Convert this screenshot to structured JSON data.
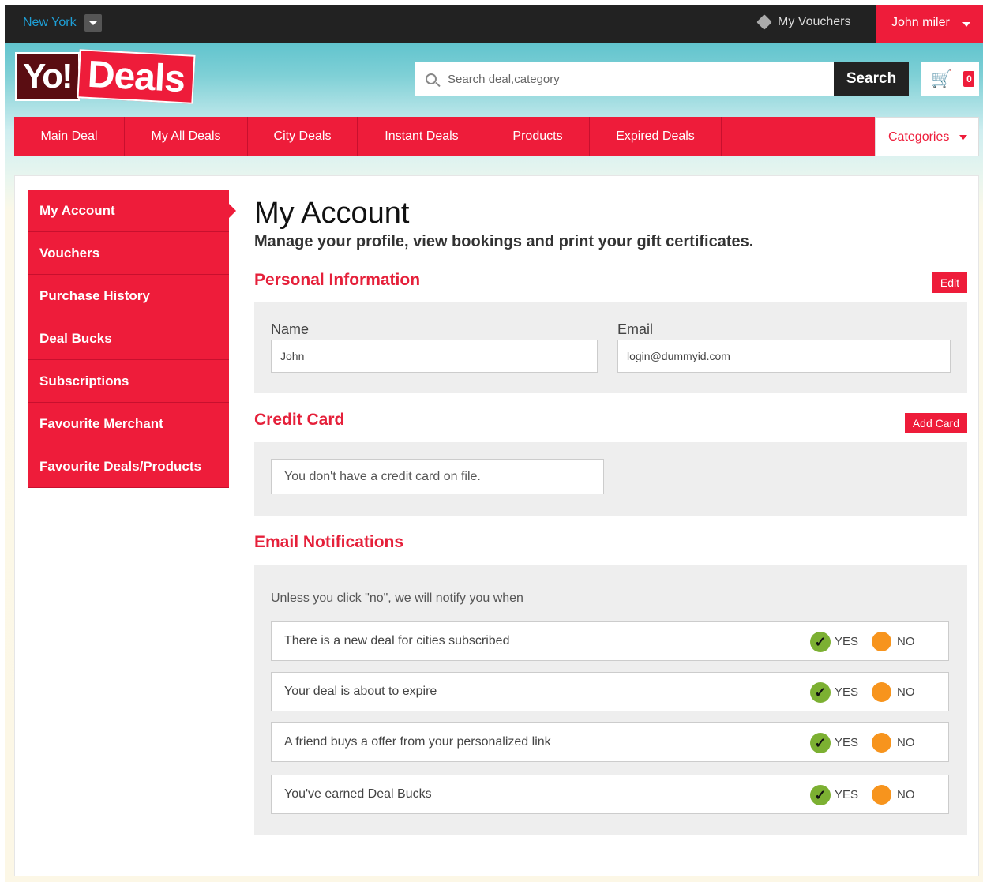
{
  "topbar": {
    "city": "New York",
    "vouchers_label": "My Vouchers",
    "user_name": "John miler"
  },
  "header": {
    "logo_yo": "Yo!",
    "logo_deals": "Deals",
    "search_placeholder": "Search deal,category",
    "search_button": "Search",
    "cart_count": "0"
  },
  "nav": {
    "items": [
      "Main Deal",
      "My All Deals",
      "City Deals",
      "Instant Deals",
      "Products",
      "Expired Deals"
    ],
    "categories": "Categories"
  },
  "sidebar": {
    "items": [
      "My Account",
      "Vouchers",
      "Purchase History",
      "Deal Bucks",
      "Subscriptions",
      "Favourite Merchant",
      "Favourite Deals/Products"
    ]
  },
  "account": {
    "title": "My Account",
    "subtitle": "Manage your profile, view bookings and print your gift certificates."
  },
  "personal": {
    "title": "Personal Information",
    "edit_label": "Edit",
    "name_label": "Name",
    "name_value": "John",
    "email_label": "Email",
    "email_value": "login@dummyid.com"
  },
  "credit_card": {
    "title": "Credit Card",
    "add_label": "Add Card",
    "message": "You don't have a credit card on file."
  },
  "notifications": {
    "title": "Email Notifications",
    "intro": "Unless you click \"no\", we will notify you when",
    "yes_label": "YES",
    "no_label": "NO",
    "rows": [
      "There is a new deal for cities subscribed",
      "Your deal is about to expire",
      "A friend buys a offer from your personalized link",
      "You've earned Deal Bucks"
    ]
  },
  "colors": {
    "brand_red": "#ee1c3a",
    "dark_bar": "#222222",
    "yes_green": "#7cb032",
    "no_orange": "#f7941d"
  }
}
